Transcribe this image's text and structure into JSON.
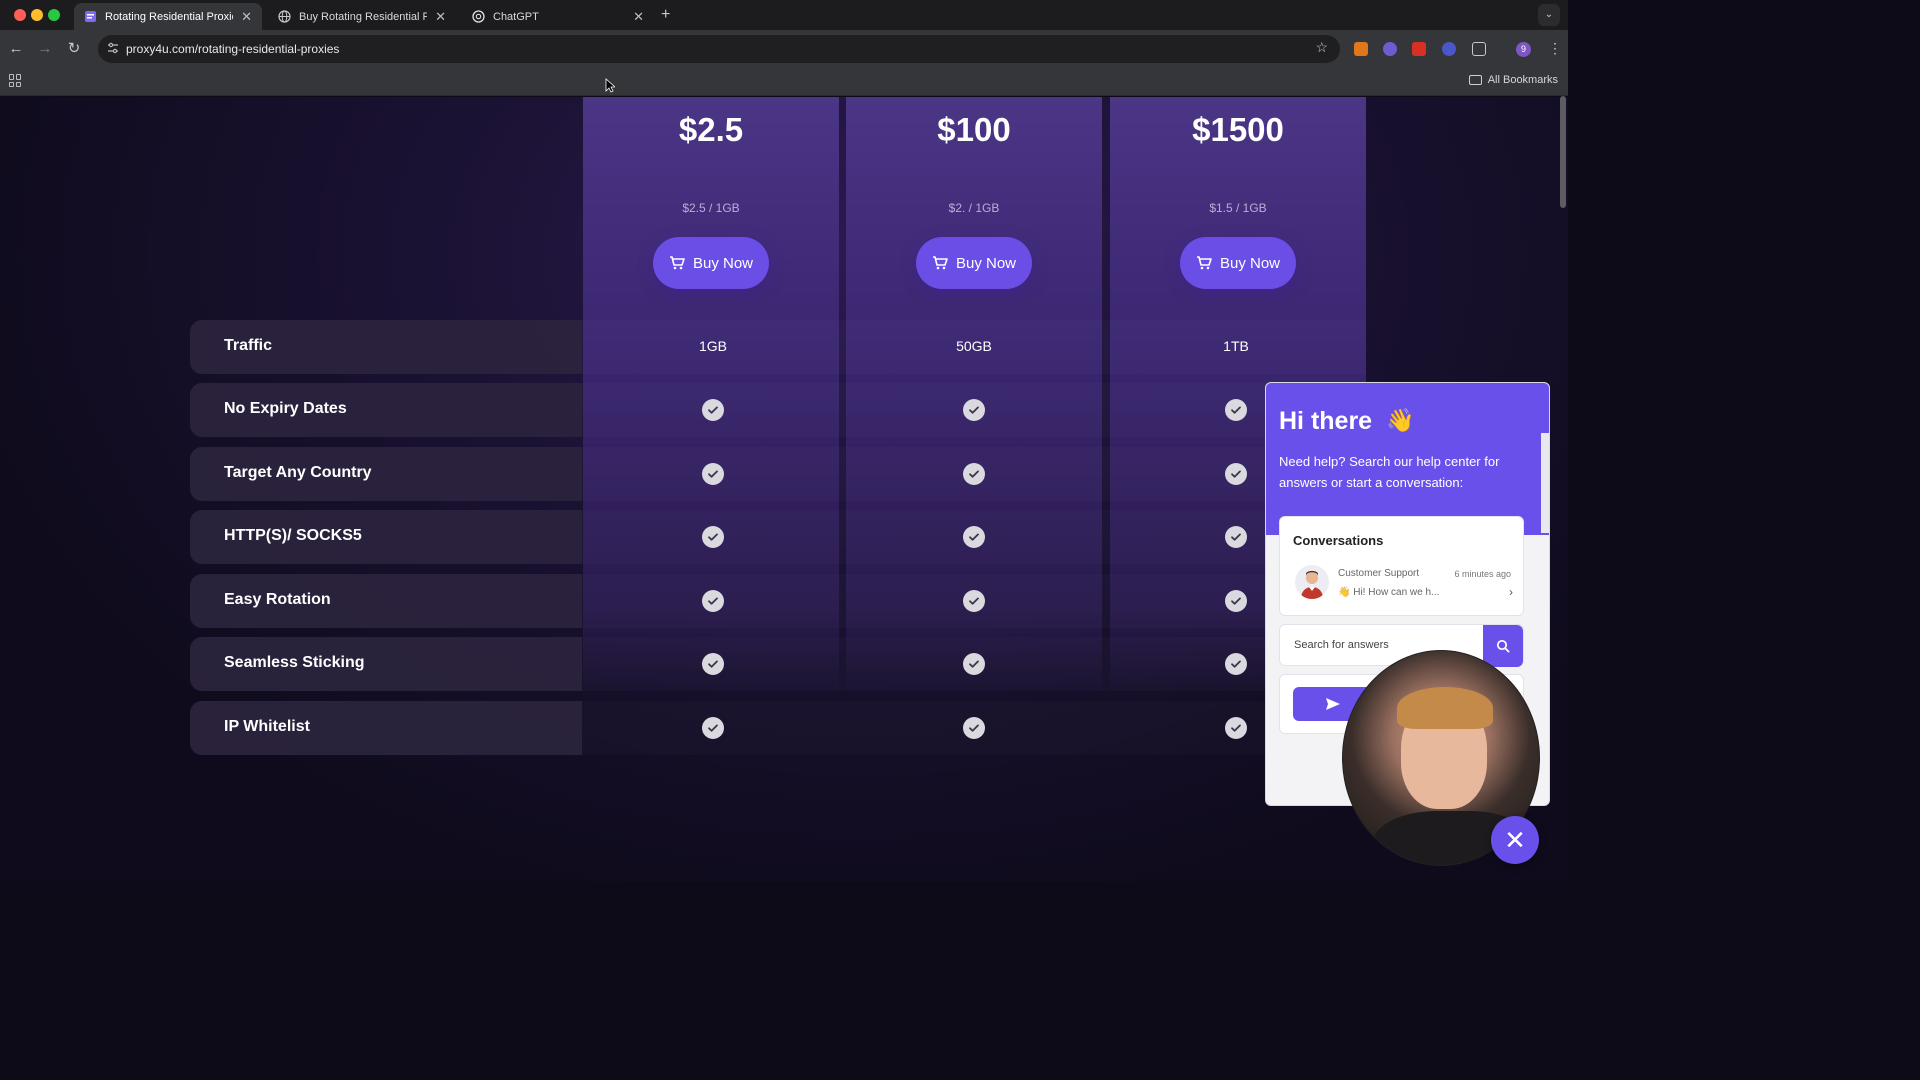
{
  "browser": {
    "tabs": [
      {
        "label": "Rotating Residential Proxies",
        "active": true
      },
      {
        "label": "Buy Rotating Residential Prox",
        "active": false
      },
      {
        "label": "ChatGPT",
        "active": false
      }
    ],
    "url": "proxy4u.com/rotating-residential-proxies",
    "profile_initial": "9",
    "bookmarks_label": "All Bookmarks"
  },
  "plans": [
    {
      "price": "$2.5",
      "unit": "$2.5 / 1GB",
      "buy_label": "Buy Now"
    },
    {
      "price": "$100",
      "unit": "$2. / 1GB",
      "buy_label": "Buy Now"
    },
    {
      "price": "$1500",
      "unit": "$1.5 / 1GB",
      "buy_label": "Buy Now"
    }
  ],
  "features": [
    {
      "label": "Traffic",
      "values": [
        "1GB",
        "50GB",
        "1TB"
      ]
    },
    {
      "label": "No Expiry Dates",
      "values": [
        "check",
        "check",
        "check"
      ]
    },
    {
      "label": "Target Any Country",
      "values": [
        "check",
        "check",
        "check"
      ]
    },
    {
      "label": "HTTP(S)/ SOCKS5",
      "values": [
        "check",
        "check",
        "check"
      ]
    },
    {
      "label": "Easy Rotation",
      "values": [
        "check",
        "check",
        "check"
      ]
    },
    {
      "label": "Seamless Sticking",
      "values": [
        "check",
        "check",
        "check"
      ]
    },
    {
      "label": "IP Whitelist",
      "values": [
        "check",
        "check",
        "check"
      ]
    }
  ],
  "chat": {
    "greeting": "Hi there",
    "greeting_emoji": "👋",
    "subtitle": "Need help? Search our help center for answers or start a conversation:",
    "conversations_title": "Conversations",
    "agent_name": "Customer Support",
    "agent_time": "6 minutes ago",
    "agent_message": "👋 Hi! How can we h...",
    "search_placeholder": "Search for answers"
  },
  "colors": {
    "accent": "#6a50ea",
    "plan_column": "#3a2570",
    "background": "#0f0b1c"
  }
}
